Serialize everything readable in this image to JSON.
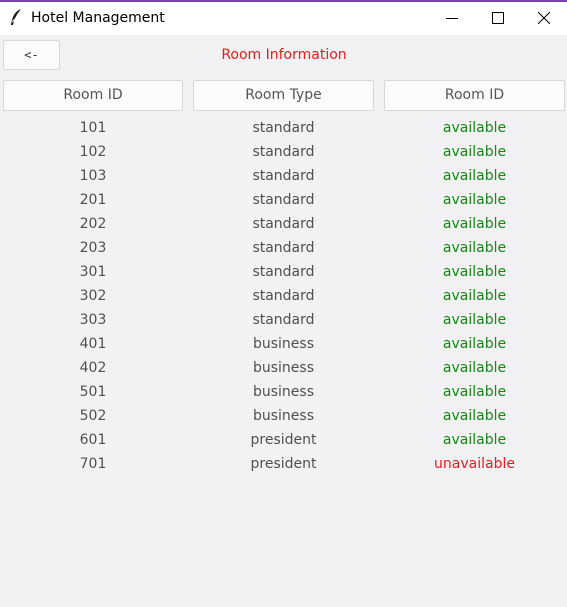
{
  "window": {
    "title": "Hotel Management",
    "icons": [
      "feather-icon",
      "minimize-icon",
      "maximize-icon",
      "close-icon"
    ]
  },
  "toolbar": {
    "back_label": "<-",
    "page_title": "Room Information"
  },
  "table": {
    "headers": [
      "Room ID",
      "Room Type",
      "Room ID"
    ],
    "rows": [
      {
        "id": "101",
        "type": "standard",
        "status": "available"
      },
      {
        "id": "102",
        "type": "standard",
        "status": "available"
      },
      {
        "id": "103",
        "type": "standard",
        "status": "available"
      },
      {
        "id": "201",
        "type": "standard",
        "status": "available"
      },
      {
        "id": "202",
        "type": "standard",
        "status": "available"
      },
      {
        "id": "203",
        "type": "standard",
        "status": "available"
      },
      {
        "id": "301",
        "type": "standard",
        "status": "available"
      },
      {
        "id": "302",
        "type": "standard",
        "status": "available"
      },
      {
        "id": "303",
        "type": "standard",
        "status": "available"
      },
      {
        "id": "401",
        "type": "business",
        "status": "available"
      },
      {
        "id": "402",
        "type": "business",
        "status": "available"
      },
      {
        "id": "501",
        "type": "business",
        "status": "available"
      },
      {
        "id": "502",
        "type": "business",
        "status": "available"
      },
      {
        "id": "601",
        "type": "president",
        "status": "available"
      },
      {
        "id": "701",
        "type": "president",
        "status": "unavailable"
      }
    ]
  },
  "colors": {
    "accent_title": "#e81c1c",
    "available": "#108a10",
    "unavailable": "#e81c1c",
    "titlebar_border": "#7a3fa8"
  }
}
